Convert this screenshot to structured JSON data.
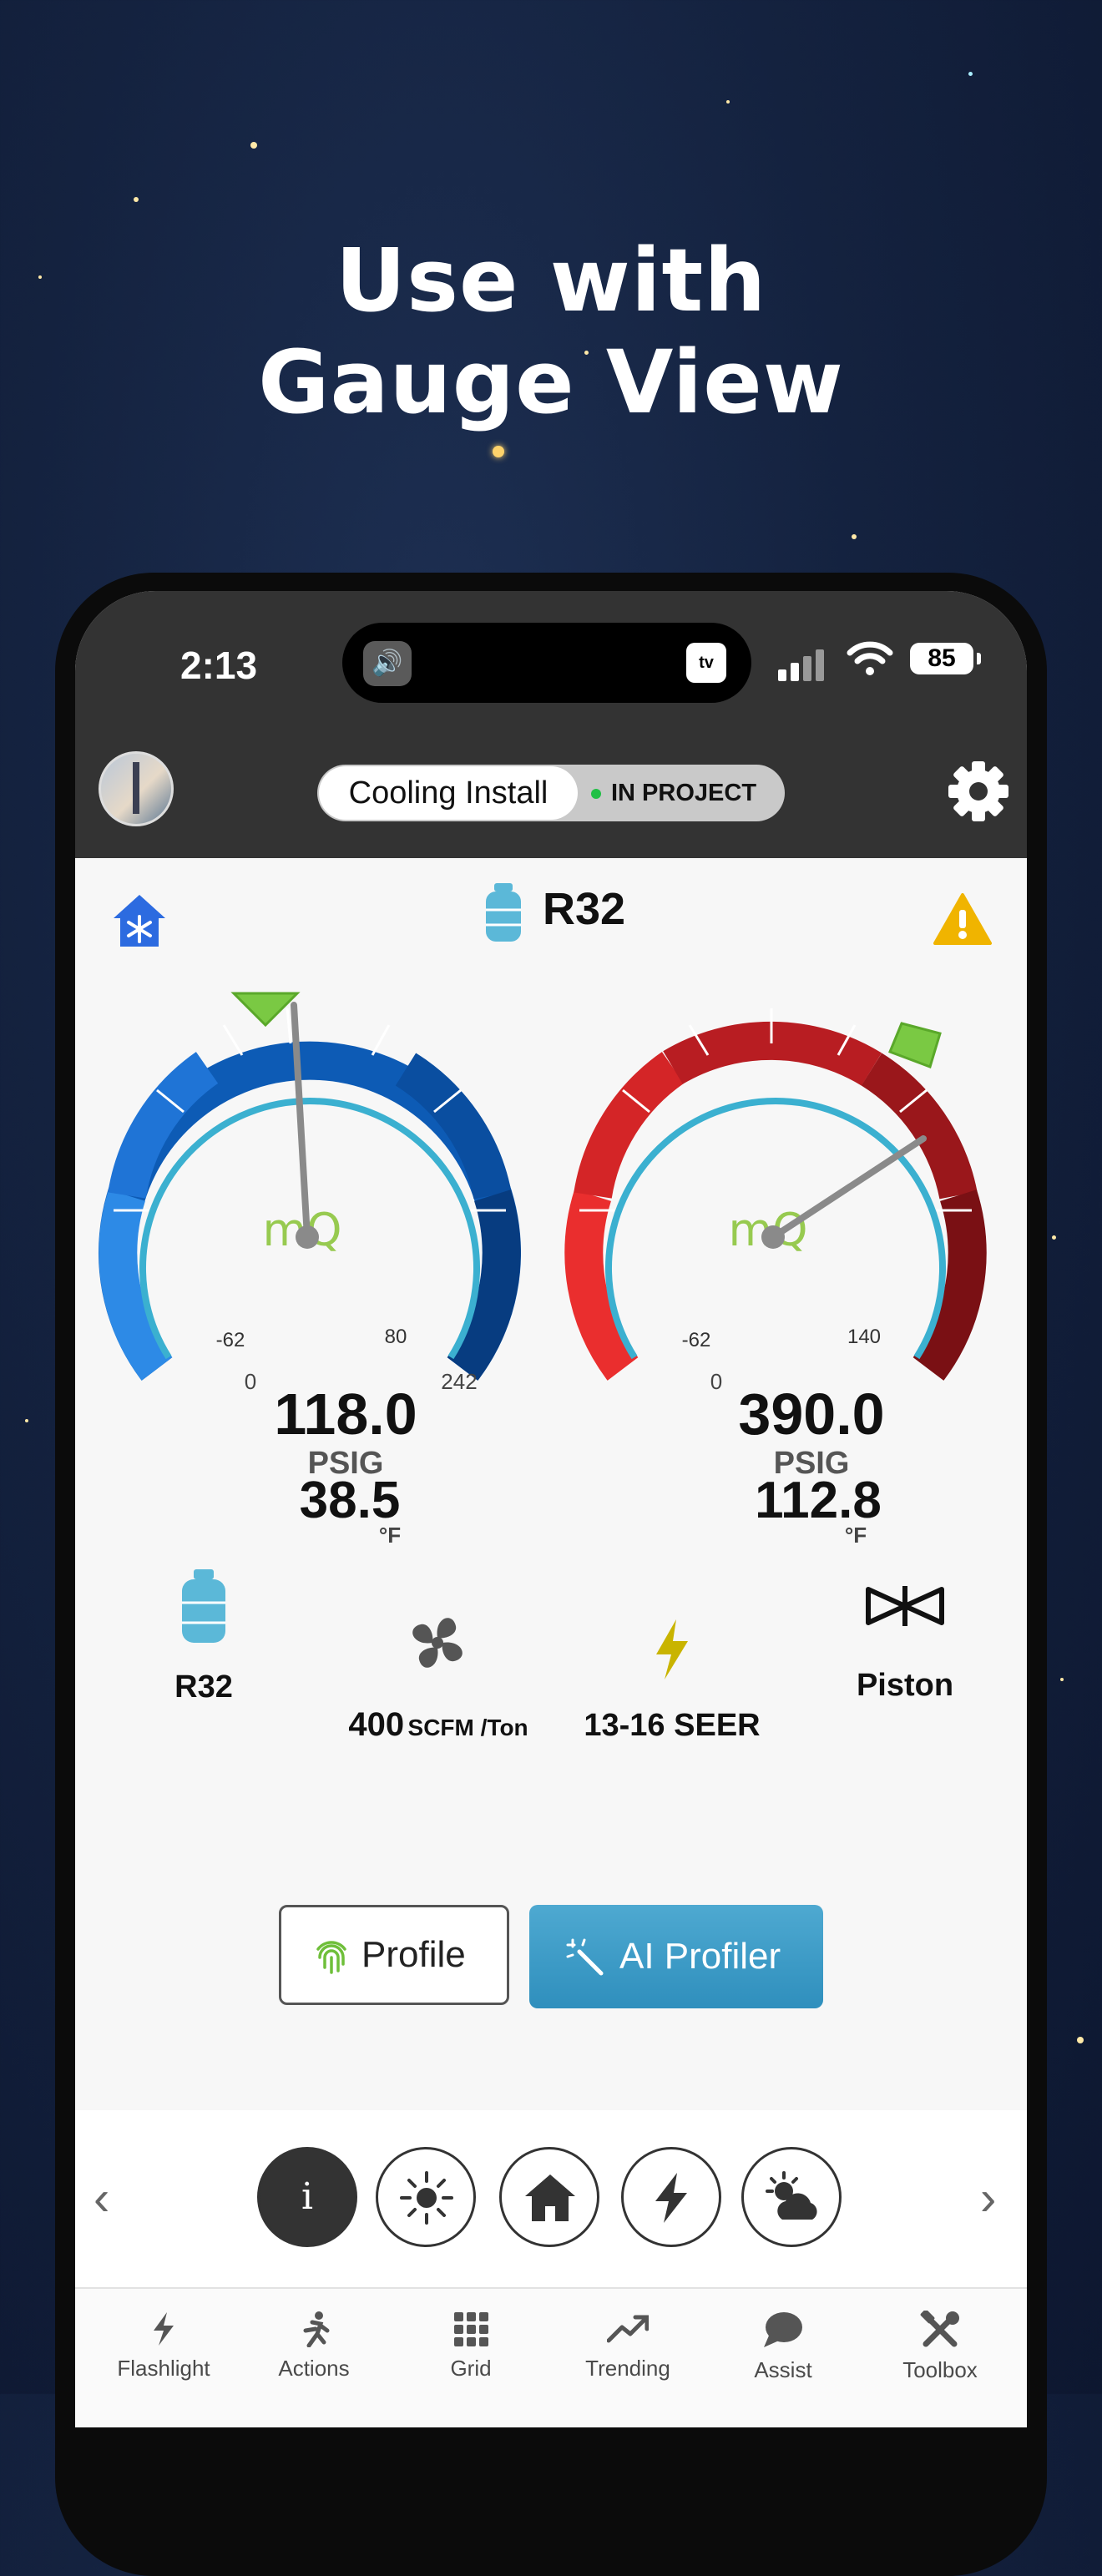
{
  "headline": {
    "line1": "Use with",
    "line2": "Gauge View"
  },
  "status_bar": {
    "time": "2:13",
    "tv_label": "tv",
    "battery": "85"
  },
  "header": {
    "project_name": "Cooling Install",
    "project_state": "IN PROJECT"
  },
  "refrigerant": {
    "name": "R32"
  },
  "gauges": [
    {
      "id": "suction",
      "temp": "38.5",
      "temp_unit": "°F",
      "temp_min": "-62",
      "temp_max": "80",
      "pressure": "118.0",
      "pressure_unit": "PSIG",
      "scale_min": "0",
      "scale_max": "242",
      "logo": "mQ",
      "color": "#1f6fd1"
    },
    {
      "id": "liquid",
      "temp": "112.8",
      "temp_unit": "°F",
      "temp_min": "-62",
      "temp_max": "140",
      "pressure": "390.0",
      "pressure_unit": "PSIG",
      "scale_min": "0",
      "scale_max": "390",
      "logo": "mQ",
      "color": "#c21f24"
    }
  ],
  "system_info": {
    "refrigerant": "R32",
    "airflow_value": "400",
    "airflow_unit": "SCFM /Ton",
    "efficiency": "13-16 SEER",
    "metering": "Piston"
  },
  "buttons": {
    "profile": "Profile",
    "ai_profiler": "AI Profiler"
  },
  "mode_icons": [
    "info-icon",
    "sun-icon",
    "house-icon",
    "bolt-icon",
    "weather-icon"
  ],
  "mode_info_glyph": "i",
  "tabs": [
    {
      "label": "Flashlight",
      "icon": "flashlight-icon"
    },
    {
      "label": "Actions",
      "icon": "running-person-icon"
    },
    {
      "label": "Grid",
      "icon": "grid-icon"
    },
    {
      "label": "Trending",
      "icon": "trending-icon"
    },
    {
      "label": "Assist",
      "icon": "chat-icon"
    },
    {
      "label": "Toolbox",
      "icon": "tools-icon"
    }
  ],
  "colors": {
    "accent_blue": "#3a9bc7",
    "warning": "#f0b400",
    "green": "#7ac943"
  }
}
